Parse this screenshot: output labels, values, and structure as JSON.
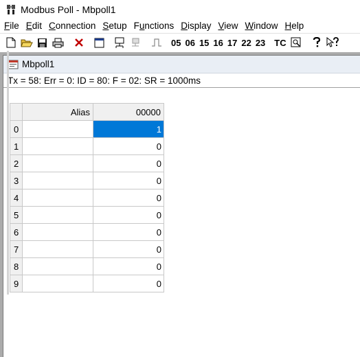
{
  "window": {
    "title": "Modbus Poll - Mbpoll1"
  },
  "menu": [
    {
      "label": "File",
      "key": "F"
    },
    {
      "label": "Edit",
      "key": "E"
    },
    {
      "label": "Connection",
      "key": "C"
    },
    {
      "label": "Setup",
      "key": "S"
    },
    {
      "label": "Functions",
      "key": "u"
    },
    {
      "label": "Display",
      "key": "D"
    },
    {
      "label": "View",
      "key": "V"
    },
    {
      "label": "Window",
      "key": "W"
    },
    {
      "label": "Help",
      "key": "H"
    }
  ],
  "toolbar": {
    "function_codes": [
      "05",
      "06",
      "15",
      "16",
      "17",
      "22",
      "23"
    ],
    "tc_label": "TC",
    "icons": [
      "new-icon",
      "open-icon",
      "save-icon",
      "print-icon",
      "delete-icon",
      "window-icon",
      "connect-icon",
      "disconnect-icon",
      "pulse-icon",
      "test-center-icon",
      "zoom-icon",
      "help-icon",
      "context-help-icon"
    ]
  },
  "child": {
    "title": "Mbpoll1",
    "status": "Tx = 58: Err = 0: ID = 80: F = 02: SR = 1000ms"
  },
  "grid": {
    "headers": {
      "alias": "Alias",
      "value": "00000"
    },
    "rows": [
      {
        "index": "0",
        "alias": "",
        "value": "1"
      },
      {
        "index": "1",
        "alias": "",
        "value": "0"
      },
      {
        "index": "2",
        "alias": "",
        "value": "0"
      },
      {
        "index": "3",
        "alias": "",
        "value": "0"
      },
      {
        "index": "4",
        "alias": "",
        "value": "0"
      },
      {
        "index": "5",
        "alias": "",
        "value": "0"
      },
      {
        "index": "6",
        "alias": "",
        "value": "0"
      },
      {
        "index": "7",
        "alias": "",
        "value": "0"
      },
      {
        "index": "8",
        "alias": "",
        "value": "0"
      },
      {
        "index": "9",
        "alias": "",
        "value": "0"
      }
    ],
    "selected_row": 0
  },
  "colors": {
    "selection": "#0078d7",
    "mdi_background": "#ababab",
    "header_background": "#f0f0f0"
  }
}
